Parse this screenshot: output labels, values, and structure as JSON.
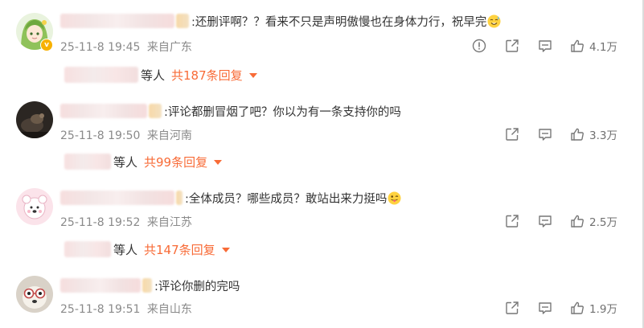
{
  "comments": [
    {
      "text": ":还删评啊？？看来不只是声明傲慢也在身体力行，祝早完",
      "emoji": "sweat-smile-emoji",
      "time": "25-11-8 19:45",
      "location": "来自广东",
      "likes": "4.1万",
      "has_report": true,
      "verified": true,
      "replies": {
        "who": "等人",
        "count": "共187条回复"
      }
    },
    {
      "text": ":评论都删冒烟了吧？你以为有一条支持你的吗",
      "emoji": "",
      "time": "25-11-8 19:50",
      "location": "来自河南",
      "likes": "3.3万",
      "has_report": false,
      "verified": false,
      "replies": {
        "who": "等人",
        "count": "共99条回复"
      }
    },
    {
      "text": ":全体成员？哪些成员？敢站出来力挺吗",
      "emoji": "tongue-out-emoji",
      "time": "25-11-8 19:52",
      "location": "来自江苏",
      "likes": "2.5万",
      "has_report": false,
      "verified": false,
      "replies": {
        "who": "等人",
        "count": "共147条回复"
      }
    },
    {
      "text": ":评论你删的完吗",
      "emoji": "",
      "time": "25-11-8 19:51",
      "location": "来自山东",
      "likes": "1.9万",
      "has_report": false,
      "verified": false,
      "replies": null
    }
  ],
  "icons": {
    "report": "report-icon",
    "share": "share-icon",
    "comment": "comment-icon",
    "like": "thumbs-up-icon",
    "expand": "caret-down-icon",
    "verified": "verified-badge-icon"
  },
  "colors": {
    "accent": "#f86b37",
    "meta_text": "#8a8a8a",
    "body_text": "#333333",
    "verified": "#f7b100"
  }
}
